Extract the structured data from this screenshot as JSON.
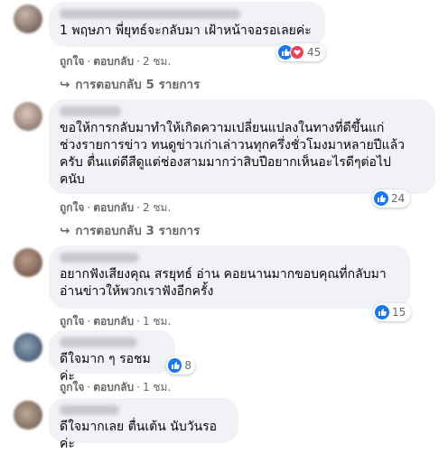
{
  "comments": [
    {
      "text_lines": [
        "1 พฤษภา พี่ยุทธ์จะกลับมา เฝ้าหน้าจอรอเลยค่ะ"
      ],
      "reaction_count": "45",
      "like": "ถูกใจ",
      "reply": "ตอบกลับ",
      "time": "2 ชม.",
      "replies_label": "การตอบกลับ 5 รายการ"
    },
    {
      "text_lines": [
        "ขอให้การกลับมาทำให้เกิดความเปลี่ยนแปลงในทางที่ดีขึ้นแก่",
        "ช่วงรายการข่าว ทนดูข่าวเก่าเล่าวนทุกครึ่งชั่วโมงมาหลายปีแล้ว",
        "ครับ ตื่นแต่ดีสีดูแต่ช่องสามมากว่าสิบปีอยากเห็นอะไรดีๆต่อไป",
        "คนับ"
      ],
      "reaction_count": "24",
      "like": "ถูกใจ",
      "reply": "ตอบกลับ",
      "time": "2 ชม.",
      "replies_label": "การตอบกลับ 3 รายการ"
    },
    {
      "text_lines": [
        "อยากฟังเสียงคุณ สรยุทธ์ อ่าน คอยนานมากขอบคุณที่กลับมา",
        "อ่านข่าวให้พวกเราฟังอีกครั้ง"
      ],
      "reaction_count": "15",
      "like": "ถูกใจ",
      "reply": "ตอบกลับ",
      "time": "1 ชม."
    },
    {
      "text_lines": [
        "ดีใจมาก ๆ รอชมค่ะ"
      ],
      "reaction_count": "8",
      "like": "ถูกใจ",
      "reply": "ตอบกลับ",
      "time": "1 ชม."
    },
    {
      "text_lines": [
        "ดีใจมากเลย ตื่นเต้น นับวันรอค่ะ"
      ]
    }
  ],
  "icons": {
    "like": "thumbs-up-icon",
    "love": "heart-icon",
    "reply_arrow": "reply-arrow-icon"
  },
  "colors": {
    "like_blue": "#1877f2",
    "love_red": "#f33e58",
    "bubble_bg": "#f0f2f5",
    "meta_gray": "#65676b"
  }
}
